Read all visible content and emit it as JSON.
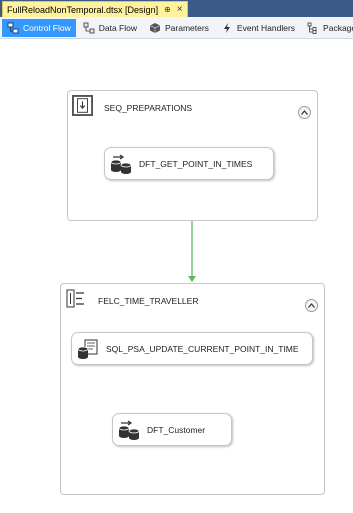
{
  "document_tab": {
    "title": "FullReloadNonTemporal.dtsx [Design]",
    "pin": "⊕",
    "close": "×"
  },
  "designer_tabs": [
    {
      "label": "Control Flow",
      "icon": "control-flow-icon",
      "active": true
    },
    {
      "label": "Data Flow",
      "icon": "data-flow-icon",
      "active": false
    },
    {
      "label": "Parameters",
      "icon": "parameters-icon",
      "active": false
    },
    {
      "label": "Event Handlers",
      "icon": "event-handlers-icon",
      "active": false
    },
    {
      "label": "Package",
      "icon": "package-explorer-icon",
      "active": false
    }
  ],
  "canvas": {
    "containers": [
      {
        "name": "SEQ_PREPARATIONS",
        "type": "sequence-container"
      },
      {
        "name": "FELC_TIME_TRAVELLER",
        "type": "foreach-loop-container"
      }
    ],
    "tasks": [
      {
        "name": "DFT_GET_POINT_IN_TIMES",
        "type": "data-flow-task"
      },
      {
        "name": "SQL_PSA_UPDATE_CURRENT_POINT_IN_TIME",
        "type": "execute-sql-task"
      },
      {
        "name": "DFT_Customer",
        "type": "data-flow-task"
      }
    ],
    "precedence_constraint_color": "#5cb85c"
  },
  "colors": {
    "titlebar": "#3c5a87",
    "active_doc_tab": "#fff29d",
    "active_designer_tab": "#3399ff"
  }
}
